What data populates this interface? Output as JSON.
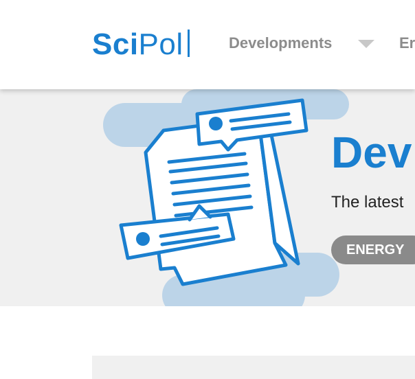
{
  "brand": {
    "part1": "Sci",
    "part2": "Pol"
  },
  "nav": [
    {
      "label": "Developments",
      "icon": "chevron-down-icon"
    },
    {
      "label": "Er"
    }
  ],
  "hero": {
    "title": "Dev",
    "subtitle": "The latest",
    "tag": "ENERGY",
    "illustration": "document-with-comments-icon"
  },
  "colors": {
    "brand": "#1a7fcf",
    "nav": "#8c8c8c",
    "hero_bg": "#f0f0f0",
    "tag_bg": "#8a8a8a"
  }
}
